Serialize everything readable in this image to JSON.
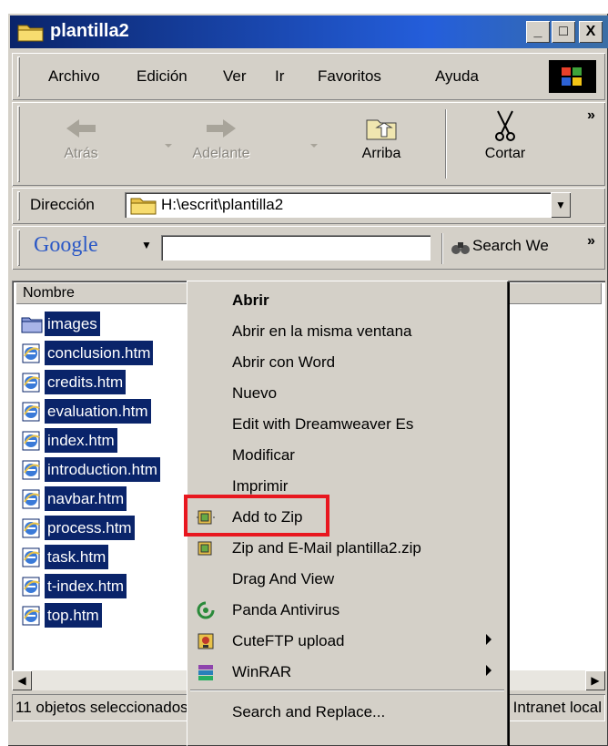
{
  "window": {
    "title": "plantilla2",
    "min": "_",
    "max": "□",
    "close": "X"
  },
  "menubar": {
    "items": [
      {
        "label": "Archivo"
      },
      {
        "label": "Edición"
      },
      {
        "label": "Ver"
      },
      {
        "label": "Ir"
      },
      {
        "label": "Favoritos"
      },
      {
        "label": "Ayuda"
      }
    ]
  },
  "toolbar": {
    "back": "Atrás",
    "forward": "Adelante",
    "up": "Arriba",
    "cut": "Cortar",
    "more": "»"
  },
  "address": {
    "label": "Dirección",
    "path": "H:\\escrit\\plantilla2"
  },
  "google": {
    "logo": "Google",
    "search_value": "",
    "search_web": "Search We",
    "more": "»"
  },
  "list": {
    "column": "Nombre",
    "files": [
      {
        "name": "images",
        "type": "folder"
      },
      {
        "name": "conclusion.htm",
        "type": "htm"
      },
      {
        "name": "credits.htm",
        "type": "htm"
      },
      {
        "name": "evaluation.htm",
        "type": "htm"
      },
      {
        "name": "index.htm",
        "type": "htm"
      },
      {
        "name": "introduction.htm",
        "type": "htm"
      },
      {
        "name": "navbar.htm",
        "type": "htm"
      },
      {
        "name": "process.htm",
        "type": "htm"
      },
      {
        "name": "task.htm",
        "type": "htm"
      },
      {
        "name": "t-index.htm",
        "type": "htm"
      },
      {
        "name": "top.htm",
        "type": "htm"
      }
    ]
  },
  "context_menu": {
    "items": [
      {
        "label": "Abrir"
      },
      {
        "label": "Abrir en la misma ventana"
      },
      {
        "label": "Abrir con Word"
      },
      {
        "label": "Nuevo"
      },
      {
        "label": "Edit with Dreamweaver Es"
      },
      {
        "label": "Modificar"
      },
      {
        "label": "Imprimir"
      },
      {
        "label": "Add to Zip"
      },
      {
        "label": "Zip and E-Mail plantilla2.zip"
      },
      {
        "label": "Drag And View"
      },
      {
        "label": "Panda Antivirus"
      },
      {
        "label": "CuteFTP upload"
      },
      {
        "label": "WinRAR"
      },
      {
        "label": "Search and Replace..."
      }
    ]
  },
  "status": {
    "left": "11 objetos seleccionados",
    "right": "Intranet local"
  },
  "colors": {
    "selection": "#0a246a",
    "highlight_box": "#e8171f",
    "face": "#d4d0c8"
  }
}
